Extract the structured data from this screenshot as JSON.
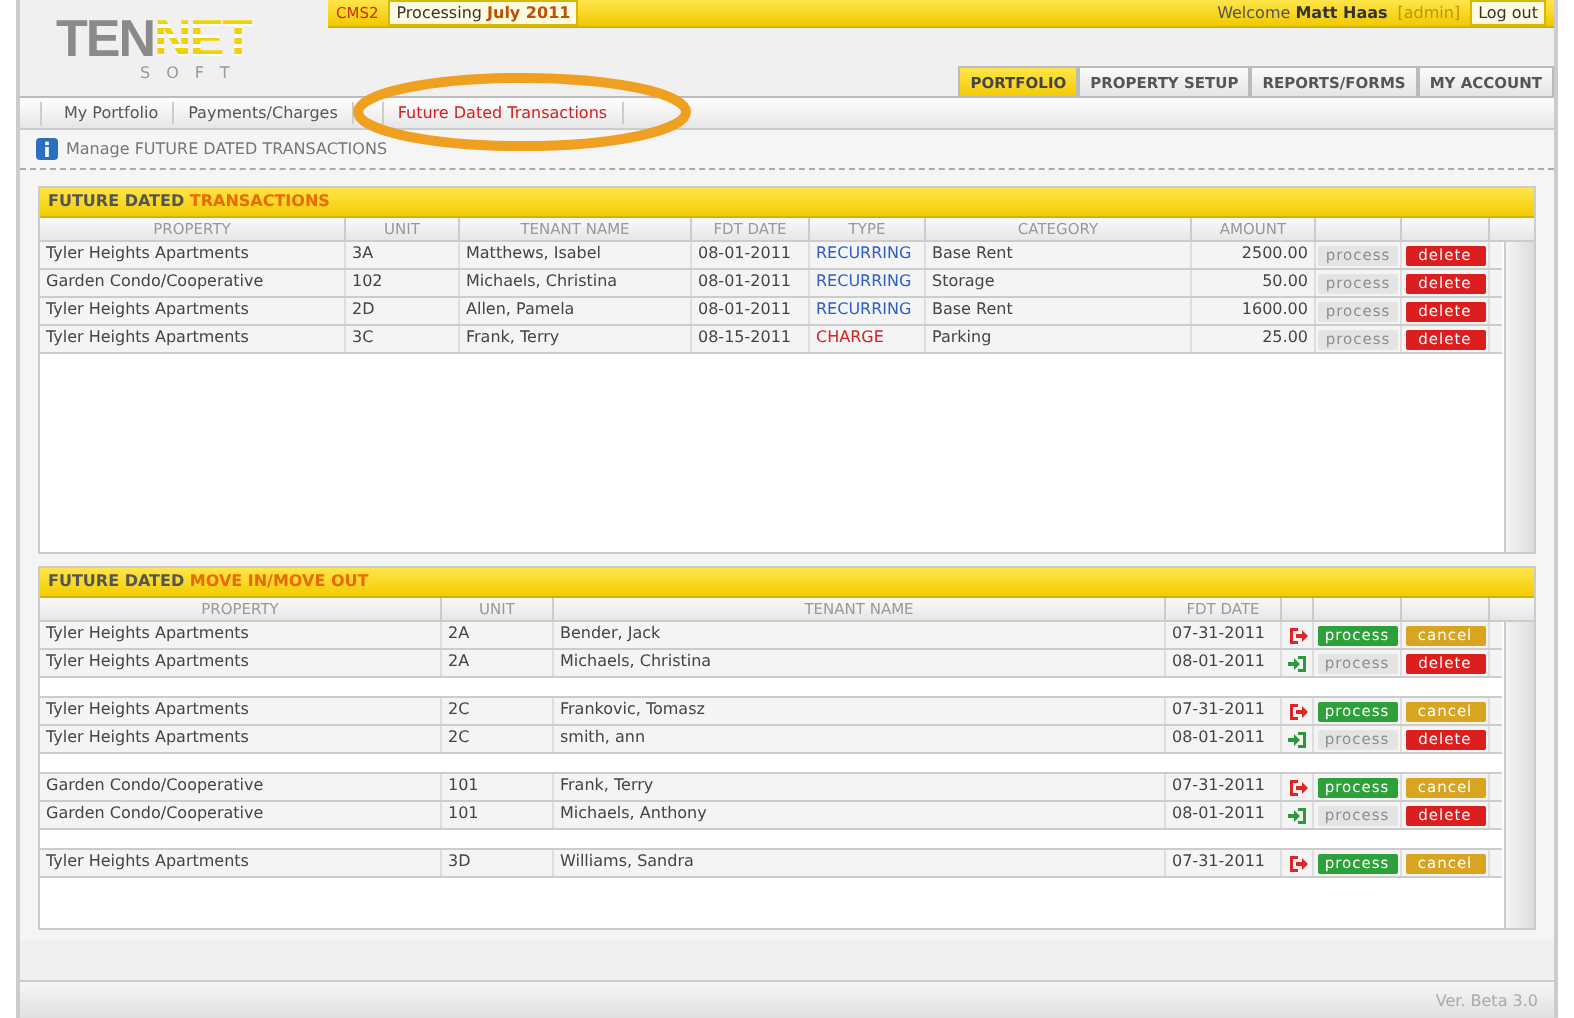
{
  "logo": {
    "part_1": "TEN",
    "part_2": "NET",
    "tagline": "SOFT"
  },
  "top_bar": {
    "app": "CMS2",
    "processing_label": "Processing",
    "processing_period": "July 2011",
    "welcome": "Welcome",
    "user": "Matt Haas",
    "role": "[admin]",
    "logout": "Log out"
  },
  "main_tabs": [
    {
      "label": "PORTFOLIO",
      "selected": true
    },
    {
      "label": "PROPERTY SETUP",
      "selected": false
    },
    {
      "label": "REPORTS/FORMS",
      "selected": false
    },
    {
      "label": "MY ACCOUNT",
      "selected": false
    }
  ],
  "sub_tabs": [
    {
      "label": "My Portfolio",
      "selected": false
    },
    {
      "label": "Payments/Charges",
      "selected": false
    },
    {
      "label": "Future Dated Transactions",
      "selected": true
    }
  ],
  "info": "Manage FUTURE DATED TRANSACTIONS",
  "transactions": {
    "title_1": "FUTURE DATED",
    "title_2": "TRANSACTIONS",
    "columns": [
      "PROPERTY",
      "UNIT",
      "TENANT NAME",
      "FDT DATE",
      "TYPE",
      "CATEGORY",
      "AMOUNT"
    ],
    "rows": [
      {
        "property": "Tyler Heights Apartments",
        "unit": "3A",
        "tenant": "Matthews, Isabel",
        "date": "08-01-2011",
        "type": "RECURRING",
        "recurring": true,
        "category": "Base Rent",
        "amount": "2500.00",
        "process": "process",
        "process_disabled": true,
        "action": "delete"
      },
      {
        "property": "Garden Condo/Cooperative",
        "unit": "102",
        "tenant": "Michaels, Christina",
        "date": "08-01-2011",
        "type": "RECURRING",
        "recurring": true,
        "category": "Storage",
        "amount": "50.00",
        "process": "process",
        "process_disabled": true,
        "action": "delete"
      },
      {
        "property": "Tyler Heights Apartments",
        "unit": "2D",
        "tenant": "Allen, Pamela",
        "date": "08-01-2011",
        "type": "RECURRING",
        "recurring": true,
        "category": "Base Rent",
        "amount": "1600.00",
        "process": "process",
        "process_disabled": true,
        "action": "delete"
      },
      {
        "property": "Tyler Heights Apartments",
        "unit": "3C",
        "tenant": "Frank, Terry",
        "date": "08-15-2011",
        "type": "CHARGE",
        "recurring": false,
        "category": "Parking",
        "amount": "25.00",
        "process": "process",
        "process_disabled": true,
        "action": "delete"
      }
    ]
  },
  "moves": {
    "title_1": "FUTURE DATED",
    "title_2": "MOVE IN/MOVE OUT",
    "columns": [
      "PROPERTY",
      "UNIT",
      "TENANT NAME",
      "FDT DATE"
    ],
    "groups": [
      {
        "rows": [
          {
            "property": "Tyler Heights Apartments",
            "unit": "2A",
            "tenant": "Bender, Jack",
            "date": "07-31-2011",
            "kind": "out",
            "process": "process",
            "process_disabled": false,
            "action": "cancel",
            "cancelable": true
          },
          {
            "property": "Tyler Heights Apartments",
            "unit": "2A",
            "tenant": "Michaels, Christina",
            "date": "08-01-2011",
            "kind": "in",
            "process": "process",
            "process_disabled": true,
            "action": "delete",
            "cancelable": false
          }
        ]
      },
      {
        "rows": [
          {
            "property": "Tyler Heights Apartments",
            "unit": "2C",
            "tenant": "Frankovic, Tomasz",
            "date": "07-31-2011",
            "kind": "out",
            "process": "process",
            "process_disabled": false,
            "action": "cancel",
            "cancelable": true
          },
          {
            "property": "Tyler Heights Apartments",
            "unit": "2C",
            "tenant": "smith, ann",
            "date": "08-01-2011",
            "kind": "in",
            "process": "process",
            "process_disabled": true,
            "action": "delete",
            "cancelable": false
          }
        ]
      },
      {
        "rows": [
          {
            "property": "Garden Condo/Cooperative",
            "unit": "101",
            "tenant": "Frank, Terry",
            "date": "07-31-2011",
            "kind": "out",
            "process": "process",
            "process_disabled": false,
            "action": "cancel",
            "cancelable": true
          },
          {
            "property": "Garden Condo/Cooperative",
            "unit": "101",
            "tenant": "Michaels, Anthony",
            "date": "08-01-2011",
            "kind": "in",
            "process": "process",
            "process_disabled": true,
            "action": "delete",
            "cancelable": false
          }
        ]
      },
      {
        "rows": [
          {
            "property": "Tyler Heights Apartments",
            "unit": "3D",
            "tenant": "Williams, Sandra",
            "date": "07-31-2011",
            "kind": "out",
            "process": "process",
            "process_disabled": false,
            "action": "cancel",
            "cancelable": true
          }
        ]
      }
    ]
  },
  "status_bar": {
    "version": "Ver. Beta 3.0"
  }
}
